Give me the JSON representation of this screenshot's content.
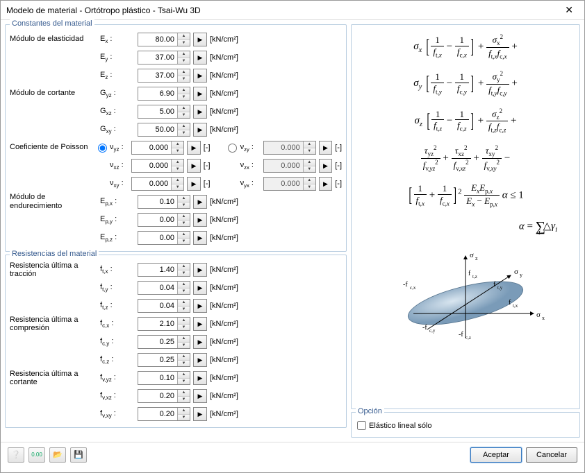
{
  "window": {
    "title": "Modelo de material - Ortótropo plástico - Tsai-Wu 3D"
  },
  "groups": {
    "constants": "Constantes del material",
    "strengths": "Resistencias del material",
    "option": "Opción"
  },
  "labels": {
    "elastic_modulus": "Módulo de elasticidad",
    "shear_modulus": "Módulo de cortante",
    "poisson": "Coeficiente de Poisson",
    "hardening": "Módulo de endurecimiento",
    "tensile": "Resistencia última a tracción",
    "compressive": "Resistencia última a compresión",
    "shear_strength": "Resistencia última a cortante",
    "linear_elastic": "Elástico lineal sólo"
  },
  "symbols": {
    "Ex": "Ex :",
    "Ey": "Ey :",
    "Ez": "Ez :",
    "Gyz": "Gyz :",
    "Gxz": "Gxz :",
    "Gxy": "Gxy :",
    "vyz": "νyz :",
    "vxz": "νxz :",
    "vxy": "νxy :",
    "vzy": "νzy :",
    "vzx": "νzx :",
    "vyx": "νyx :",
    "Epx": "Ep,x :",
    "Epy": "Ep,y :",
    "Epz": "Ep,z :",
    "ftx": "ft,x :",
    "fty": "ft,y :",
    "ftz": "ft,z :",
    "fcx": "fc,x :",
    "fcy": "fc,y :",
    "fcz": "fc,z :",
    "fvyz": "fv,yz :",
    "fvxz": "fv,xz :",
    "fvxy": "fv,xy :"
  },
  "values": {
    "Ex": "80.00",
    "Ey": "37.00",
    "Ez": "37.00",
    "Gyz": "6.90",
    "Gxz": "5.00",
    "Gxy": "50.00",
    "vyz": "0.000",
    "vxz": "0.000",
    "vxy": "0.000",
    "vzy": "0.000",
    "vzx": "0.000",
    "vyx": "0.000",
    "Epx": "0.10",
    "Epy": "0.00",
    "Epz": "0.00",
    "ftx": "1.40",
    "fty": "0.04",
    "ftz": "0.04",
    "fcx": "2.10",
    "fcy": "0.25",
    "fcz": "0.25",
    "fvyz": "0.10",
    "fvxz": "0.20",
    "fvxy": "0.20"
  },
  "units": {
    "stress": "[kN/cm²]",
    "none": "[-]"
  },
  "buttons": {
    "accept": "Aceptar",
    "cancel": "Cancelar",
    "ext": "▶"
  },
  "diagram_labels": {
    "sz": "σz",
    "sy": "σy",
    "sx": "σx",
    "fcx": "-fc,x",
    "fcy": "-fc,y",
    "fcz": "-fc,z",
    "ftx": "ft,x",
    "fty": "ft,y",
    "ftz": "ft,z"
  }
}
